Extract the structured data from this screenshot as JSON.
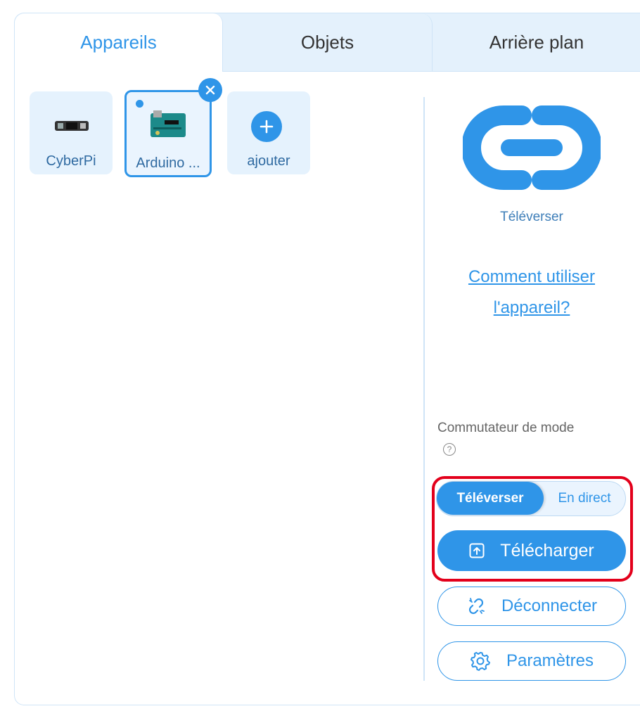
{
  "tabs": {
    "devices": "Appareils",
    "objects": "Objets",
    "background": "Arrière plan"
  },
  "devices": [
    {
      "label": "CyberPi",
      "icon": "cyberpi-board-icon",
      "selected": false
    },
    {
      "label": "Arduino ...",
      "icon": "arduino-board-icon",
      "selected": true
    }
  ],
  "add_device": {
    "label": "ajouter",
    "icon": "plus-icon"
  },
  "connection": {
    "icon": "link-icon",
    "label": "Téléverser",
    "howto_line1": "Comment utiliser",
    "howto_line2": "l'appareil?"
  },
  "mode": {
    "label": "Commutateur de mode",
    "help": "?",
    "option_upload": "Téléverser",
    "option_live": "En direct",
    "selected": "Téléverser"
  },
  "actions": {
    "download": "Télécharger",
    "disconnect": "Déconnecter",
    "settings": "Paramètres"
  },
  "colors": {
    "accent": "#2f95e8",
    "highlight": "#e3001b"
  }
}
